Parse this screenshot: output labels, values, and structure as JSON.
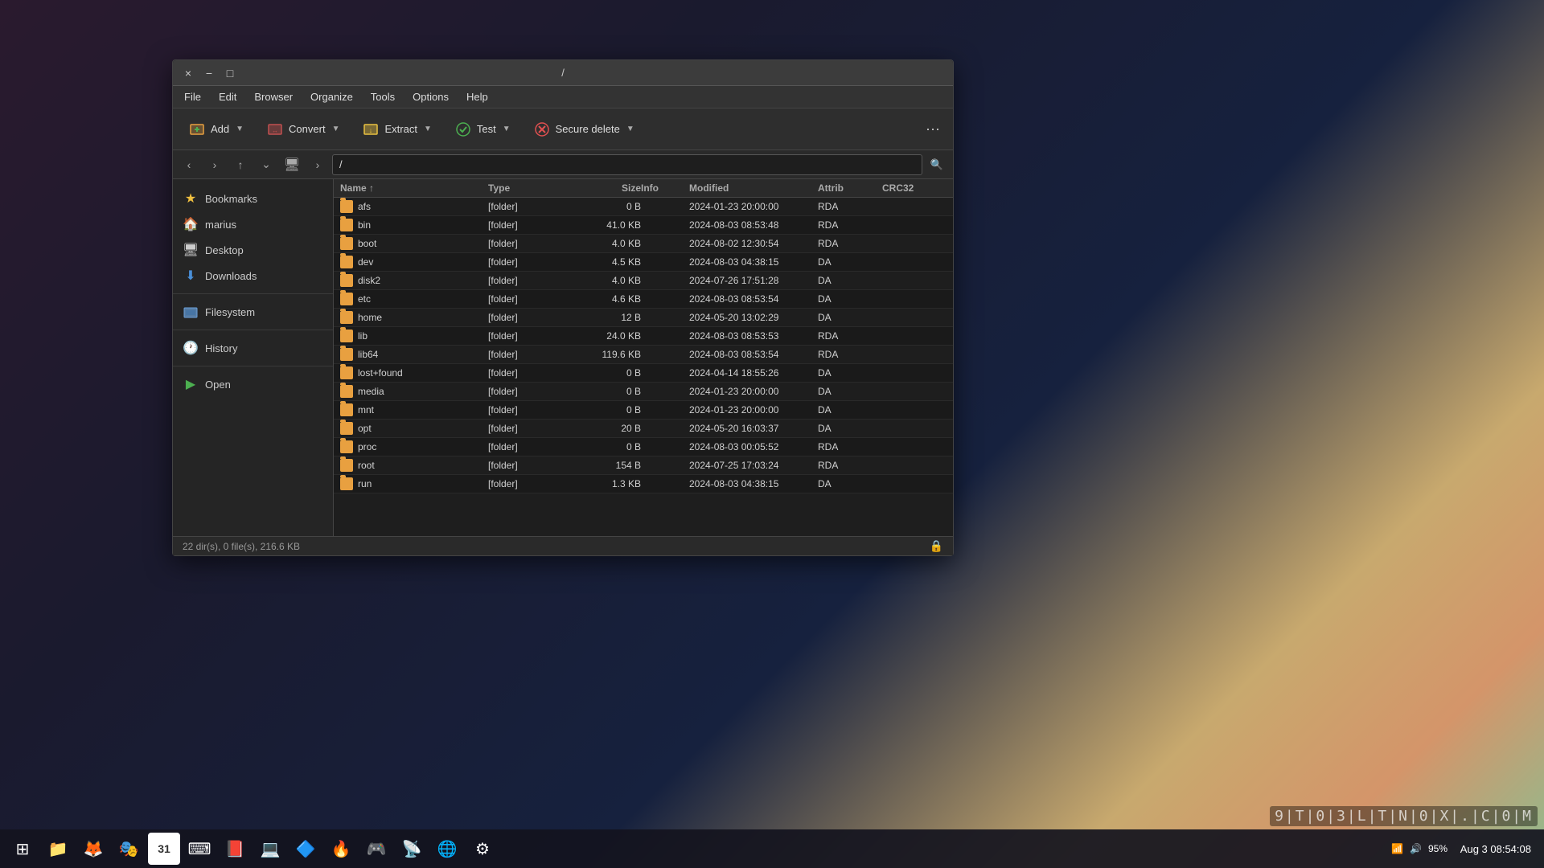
{
  "window": {
    "title": "/",
    "close_btn": "×",
    "minimize_btn": "−",
    "maximize_btn": "□"
  },
  "menu": {
    "items": [
      "File",
      "Edit",
      "Browser",
      "Organize",
      "Tools",
      "Options",
      "Help"
    ]
  },
  "toolbar": {
    "add_label": "Add",
    "convert_label": "Convert",
    "extract_label": "Extract",
    "test_label": "Test",
    "secure_delete_label": "Secure delete",
    "more_icon": "···"
  },
  "addressbar": {
    "path": "/",
    "back_icon": "‹",
    "forward_icon": "›",
    "up_icon": "↑",
    "monitor_icon": "🖥",
    "arrow_icon": "›",
    "search_icon": "🔍"
  },
  "sidebar": {
    "items": [
      {
        "label": "Bookmarks",
        "icon": "★",
        "type": "bookmarks"
      },
      {
        "label": "marius",
        "icon": "🏠",
        "type": "home"
      },
      {
        "label": "Desktop",
        "icon": "🖥",
        "type": "desktop"
      },
      {
        "label": "Downloads",
        "icon": "⬇",
        "type": "downloads"
      },
      {
        "label": "Filesystem",
        "icon": "📁",
        "type": "filesystem"
      },
      {
        "label": "History",
        "icon": "🕐",
        "type": "history"
      },
      {
        "label": "Open",
        "icon": "▶",
        "type": "open"
      }
    ]
  },
  "filelist": {
    "columns": [
      "Name ↑",
      "Type",
      "Size",
      "Info",
      "Modified",
      "Attrib",
      "CRC32"
    ],
    "rows": [
      {
        "name": "afs",
        "type": "[folder]",
        "size": "0 B",
        "info": "",
        "modified": "2024-01-23 20:00:00",
        "attrib": "RDA",
        "crc32": ""
      },
      {
        "name": "bin",
        "type": "[folder]",
        "size": "41.0 KB",
        "info": "",
        "modified": "2024-08-03 08:53:48",
        "attrib": "RDA",
        "crc32": ""
      },
      {
        "name": "boot",
        "type": "[folder]",
        "size": "4.0 KB",
        "info": "",
        "modified": "2024-08-02 12:30:54",
        "attrib": "RDA",
        "crc32": ""
      },
      {
        "name": "dev",
        "type": "[folder]",
        "size": "4.5 KB",
        "info": "",
        "modified": "2024-08-03 04:38:15",
        "attrib": "DA",
        "crc32": ""
      },
      {
        "name": "disk2",
        "type": "[folder]",
        "size": "4.0 KB",
        "info": "",
        "modified": "2024-07-26 17:51:28",
        "attrib": "DA",
        "crc32": ""
      },
      {
        "name": "etc",
        "type": "[folder]",
        "size": "4.6 KB",
        "info": "",
        "modified": "2024-08-03 08:53:54",
        "attrib": "DA",
        "crc32": ""
      },
      {
        "name": "home",
        "type": "[folder]",
        "size": "12 B",
        "info": "",
        "modified": "2024-05-20 13:02:29",
        "attrib": "DA",
        "crc32": ""
      },
      {
        "name": "lib",
        "type": "[folder]",
        "size": "24.0 KB",
        "info": "",
        "modified": "2024-08-03 08:53:53",
        "attrib": "RDA",
        "crc32": ""
      },
      {
        "name": "lib64",
        "type": "[folder]",
        "size": "119.6 KB",
        "info": "",
        "modified": "2024-08-03 08:53:54",
        "attrib": "RDA",
        "crc32": ""
      },
      {
        "name": "lost+found",
        "type": "[folder]",
        "size": "0 B",
        "info": "",
        "modified": "2024-04-14 18:55:26",
        "attrib": "DA",
        "crc32": ""
      },
      {
        "name": "media",
        "type": "[folder]",
        "size": "0 B",
        "info": "",
        "modified": "2024-01-23 20:00:00",
        "attrib": "DA",
        "crc32": ""
      },
      {
        "name": "mnt",
        "type": "[folder]",
        "size": "0 B",
        "info": "",
        "modified": "2024-01-23 20:00:00",
        "attrib": "DA",
        "crc32": ""
      },
      {
        "name": "opt",
        "type": "[folder]",
        "size": "20 B",
        "info": "",
        "modified": "2024-05-20 16:03:37",
        "attrib": "DA",
        "crc32": ""
      },
      {
        "name": "proc",
        "type": "[folder]",
        "size": "0 B",
        "info": "",
        "modified": "2024-08-03 00:05:52",
        "attrib": "RDA",
        "crc32": ""
      },
      {
        "name": "root",
        "type": "[folder]",
        "size": "154 B",
        "info": "",
        "modified": "2024-07-25 17:03:24",
        "attrib": "RDA",
        "crc32": ""
      },
      {
        "name": "run",
        "type": "[folder]",
        "size": "1.3 KB",
        "info": "",
        "modified": "2024-08-03 04:38:15",
        "attrib": "DA",
        "crc32": ""
      }
    ]
  },
  "statusbar": {
    "info": "22 dir(s), 0 file(s), 216.6 KB"
  },
  "taskbar": {
    "time": "Aug 3   08:54:08",
    "battery": "95%",
    "apps": [
      {
        "name": "grid-menu",
        "icon": "⊞"
      },
      {
        "name": "files",
        "icon": "📁"
      },
      {
        "name": "firefox",
        "icon": "🦊"
      },
      {
        "name": "audio",
        "icon": "🎭"
      },
      {
        "name": "calendar",
        "icon": "31"
      },
      {
        "name": "terminal",
        "icon": "⌨"
      },
      {
        "name": "rednotebook",
        "icon": "📕"
      },
      {
        "name": "virtualbox",
        "icon": "💻"
      },
      {
        "name": "another-app",
        "icon": "🔷"
      },
      {
        "name": "game-app",
        "icon": "🔥"
      },
      {
        "name": "steam",
        "icon": "🎮"
      },
      {
        "name": "filezilla",
        "icon": "📡"
      },
      {
        "name": "browser2",
        "icon": "🌐"
      },
      {
        "name": "settings",
        "icon": "⚙"
      }
    ]
  },
  "watermark": {
    "text": "9|T|0|3|L|T|N|0|X|.|C|0|M"
  }
}
